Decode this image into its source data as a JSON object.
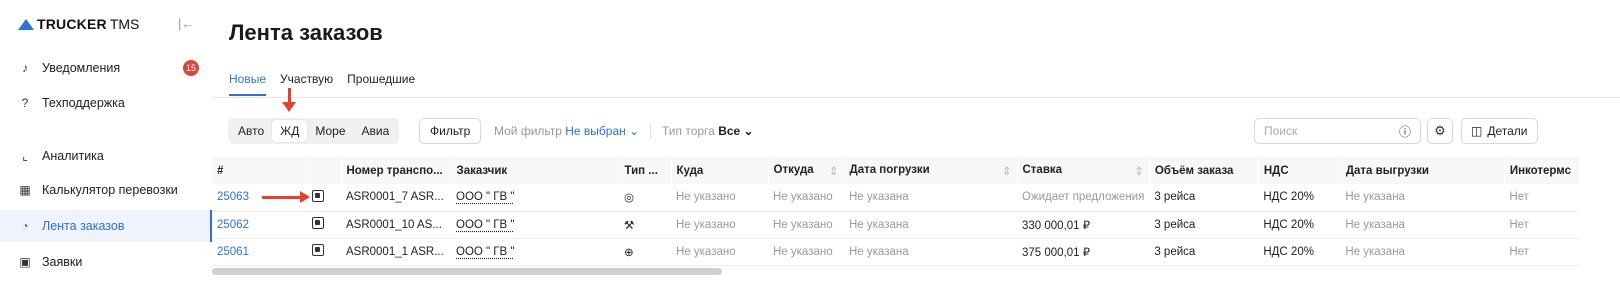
{
  "sidebar": {
    "logo_bold": "TRUCKER",
    "logo_rest": "TMS",
    "notifications_label": "Уведомления",
    "notifications_badge": "15",
    "support_label": "Техподдержка",
    "items": [
      {
        "label": "Аналитика",
        "icon": "chart-icon"
      },
      {
        "label": "Калькулятор перевозки",
        "icon": "calculator-icon"
      },
      {
        "label": "Лента заказов",
        "icon": "feed-icon"
      },
      {
        "label": "Заявки",
        "icon": "document-icon"
      }
    ],
    "active_index": 2
  },
  "main": {
    "title": "Лента заказов",
    "tabs": [
      "Новые",
      "Участвую",
      "Прошедшие"
    ],
    "active_tab": 0
  },
  "filters": {
    "transport_modes": [
      "Авто",
      "ЖД",
      "Море",
      "Авиа"
    ],
    "active_mode": 1,
    "filter_button": "Фильтр",
    "my_filter_label": "Мой фильтр",
    "my_filter_value": "Не выбран",
    "trade_type_label": "Тип торга",
    "trade_type_value": "Все",
    "search_placeholder": "Поиск",
    "details_button": "Детали"
  },
  "table": {
    "columns": [
      "#",
      "",
      "Номер транспо...",
      "Заказчик",
      "Тип ...",
      "Куда",
      "Откуда",
      "Дата погрузки",
      "Ставка",
      "Объём заказа",
      "НДС",
      "Дата выгрузки",
      "Инкотермс"
    ],
    "rows": [
      {
        "id": "25063",
        "number": "ASR0001_7 ASR...",
        "customer": "ООО \" ГВ \"",
        "type_icon": "target-icon",
        "to": "Не указано",
        "from": "Не указано",
        "load_date": "Не указана",
        "rate": "Ожидает предложения",
        "volume": "3 рейса",
        "vat": "НДС 20%",
        "unload_date": "Не указана",
        "incoterms": "Нет"
      },
      {
        "id": "25062",
        "number": "ASR0001_10 AS...",
        "customer": "ООО \" ГВ \"",
        "type_icon": "hammer-icon",
        "to": "Не указано",
        "from": "Не указано",
        "load_date": "Не указана",
        "rate": "330 000,01 ₽",
        "volume": "3 рейса",
        "vat": "НДС 20%",
        "unload_date": "Не указана",
        "incoterms": "Нет"
      },
      {
        "id": "25061",
        "number": "ASR0001_1 ASR...",
        "customer": "ООО \" ГВ \"",
        "type_icon": "crosshair-icon",
        "to": "Не указано",
        "from": "Не указано",
        "load_date": "Не указана",
        "rate": "375 000,01 ₽",
        "volume": "3 рейса",
        "vat": "НДС 20%",
        "unload_date": "Не указана",
        "incoterms": "Нет"
      }
    ]
  },
  "colors": {
    "accent": "#2f6fe0",
    "badge": "#e0443a",
    "annotation_arrow": "#e0442e"
  }
}
